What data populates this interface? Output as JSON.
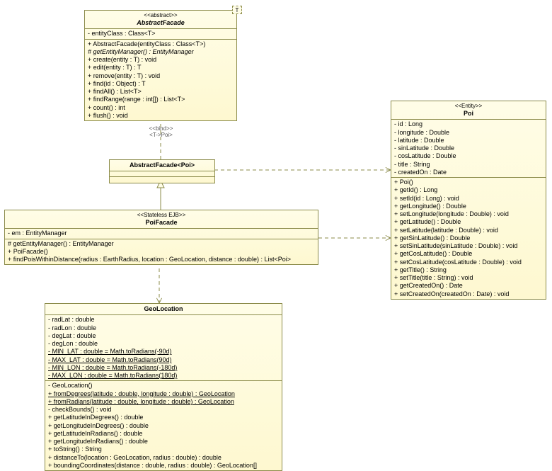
{
  "classes": {
    "abstractFacade": {
      "stereotype": "<<abstract>>",
      "name": "AbstractFacade",
      "tparam": "T",
      "attrs": [
        "- entityClass : Class<T>"
      ],
      "ops": [
        "+ AbstractFacade(entityClass : Class<T>)",
        "# getEntityManager() : EntityManager",
        "+ create(entity : T) : void",
        "+ edit(entity : T) : T",
        "+ remove(entity : T) : void",
        "+ find(id : Object) : T",
        "+ findAll() : List<T>",
        "+ findRange(range : int[]) : List<T>",
        "+ count() : int",
        "+ flush() : void"
      ]
    },
    "abstractFacadePoi": {
      "name": "AbstractFacade<Poi>"
    },
    "poiFacade": {
      "stereotype": "<<Stateless EJB>>",
      "name": "PoiFacade",
      "attrs": [
        "- em : EntityManager"
      ],
      "ops": [
        "# getEntityManager() : EntityManager",
        "+ PoiFacade()",
        "+ findPoisWithinDistance(radius : EarthRadius, location : GeoLocation, distance : double) : List<Poi>"
      ]
    },
    "geoLocation": {
      "name": "GeoLocation",
      "attrs": [
        {
          "t": "- radLat : double"
        },
        {
          "t": "- radLon : double"
        },
        {
          "t": "- degLat : double"
        },
        {
          "t": "- degLon : double"
        },
        {
          "t": "- MIN_LAT : double = Math.toRadians(-90d)",
          "u": true
        },
        {
          "t": "- MAX_LAT : double = Math.toRadians(90d)",
          "u": true
        },
        {
          "t": "- MIN_LON : double = Math.toRadians(-180d)",
          "u": true
        },
        {
          "t": "- MAX_LON : double = Math.toRadians(180d)",
          "u": true
        }
      ],
      "ops": [
        {
          "t": "- GeoLocation()"
        },
        {
          "t": "+ fromDegrees(latitude : double, longitude : double) : GeoLocation",
          "u": true
        },
        {
          "t": "+ fromRadians(latitude : double, longitude : double) : GeoLocation",
          "u": true
        },
        {
          "t": "- checkBounds() : void"
        },
        {
          "t": "+ getLatitudeInDegrees() : double"
        },
        {
          "t": "+ getLongitudeInDegrees() : double"
        },
        {
          "t": "+ getLatitudeInRadians() : double"
        },
        {
          "t": "+ getLongitudeInRadians() : double"
        },
        {
          "t": "+ toString() : String"
        },
        {
          "t": "+ distanceTo(location : GeoLocation, radius : double) : double"
        },
        {
          "t": "+ boundingCoordinates(distance : double, radius : double) : GeoLocation[]"
        }
      ]
    },
    "poi": {
      "stereotype": "<<Entity>>",
      "name": "Poi",
      "attrs": [
        "- id : Long",
        "- longitude : Double",
        "- latitude : Double",
        "- sinLatitude : Double",
        "- cosLatitude : Double",
        "- title : String",
        "- createdOn : Date"
      ],
      "ops": [
        "+ Poi()",
        "+ getId() : Long",
        "+ setId(id : Long) : void",
        "+ getLongitude() : Double",
        "+ setLongitude(longitude : Double) : void",
        "+ getLatitude() : Double",
        "+ setLatitude(latitude : Double) : void",
        "+ getSinLatitude() : Double",
        "+ setSinLatitude(sinLatitude : Double) : void",
        "+ getCosLatitude() : Double",
        "+ setCosLatitude(cosLatitude : Double) : void",
        "+ getTitle() : String",
        "+ setTitle(title : String) : void",
        "+ getCreatedOn() : Date",
        "+ setCreatedOn(createdOn : Date) : void"
      ]
    }
  },
  "labels": {
    "bind": "<<bind>>",
    "bindSub": "<T->Poi>"
  }
}
